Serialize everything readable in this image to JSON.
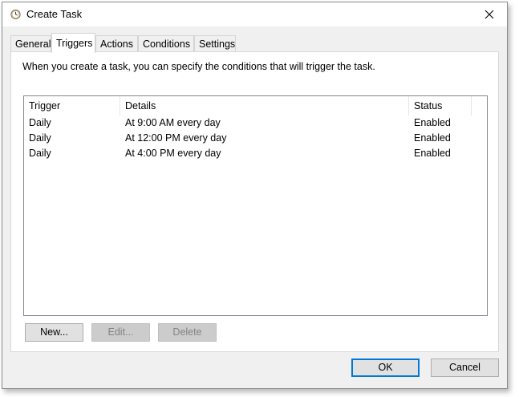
{
  "window": {
    "title": "Create Task"
  },
  "tabs": [
    {
      "label": "General"
    },
    {
      "label": "Triggers"
    },
    {
      "label": "Actions"
    },
    {
      "label": "Conditions"
    },
    {
      "label": "Settings"
    }
  ],
  "active_tab": "Triggers",
  "triggers_panel": {
    "description": "When you create a task, you can specify the conditions that will trigger the task.",
    "columns": {
      "trigger": "Trigger",
      "details": "Details",
      "status": "Status"
    },
    "rows": [
      {
        "trigger": "Daily",
        "details": "At 9:00 AM every day",
        "status": "Enabled"
      },
      {
        "trigger": "Daily",
        "details": "At 12:00 PM every day",
        "status": "Enabled"
      },
      {
        "trigger": "Daily",
        "details": "At 4:00 PM every day",
        "status": "Enabled"
      }
    ],
    "buttons": {
      "new": "New...",
      "edit": "Edit...",
      "delete": "Delete"
    }
  },
  "footer": {
    "ok": "OK",
    "cancel": "Cancel"
  },
  "colors": {
    "accent": "#0078d7",
    "disabled_text": "#838383"
  }
}
